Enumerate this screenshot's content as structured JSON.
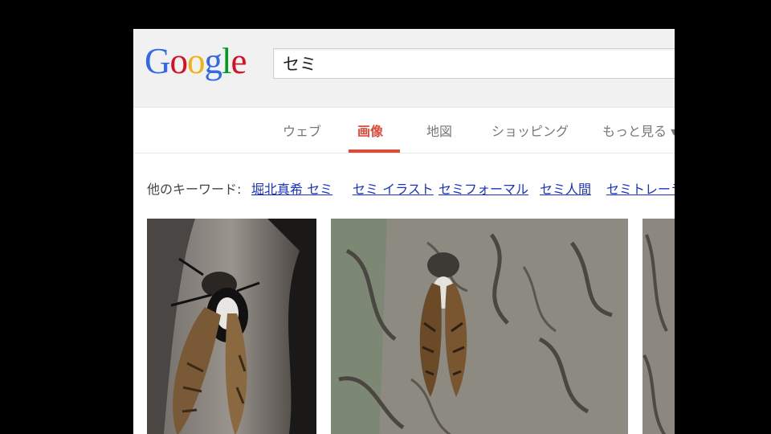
{
  "logo": {
    "text": "Google",
    "letters": [
      "G",
      "o",
      "o",
      "g",
      "l",
      "e"
    ],
    "colors": [
      "#3369e8",
      "#d50f25",
      "#eeb211",
      "#3369e8",
      "#009925",
      "#d50f25"
    ]
  },
  "search": {
    "value": "セミ"
  },
  "tabs": [
    {
      "label": "ウェブ",
      "active": false
    },
    {
      "label": "画像",
      "active": true
    },
    {
      "label": "地図",
      "active": false
    },
    {
      "label": "ショッピング",
      "active": false
    },
    {
      "label": "もっと見る ▾",
      "active": false
    }
  ],
  "related": {
    "prefix": "他のキーワード:",
    "links": [
      "堀北真希 セミ",
      "セミ イラスト",
      "セミフォーマル",
      "セミ人間",
      "セミトレーラ"
    ]
  },
  "colors": {
    "active_tab": "#dd4b39",
    "link": "#1a32c8",
    "header_bg": "#f1f1f1"
  },
  "results": [
    {
      "subject": "cicada-on-dark-bark"
    },
    {
      "subject": "cicada-on-gray-bark"
    },
    {
      "subject": "bark-partial"
    }
  ]
}
